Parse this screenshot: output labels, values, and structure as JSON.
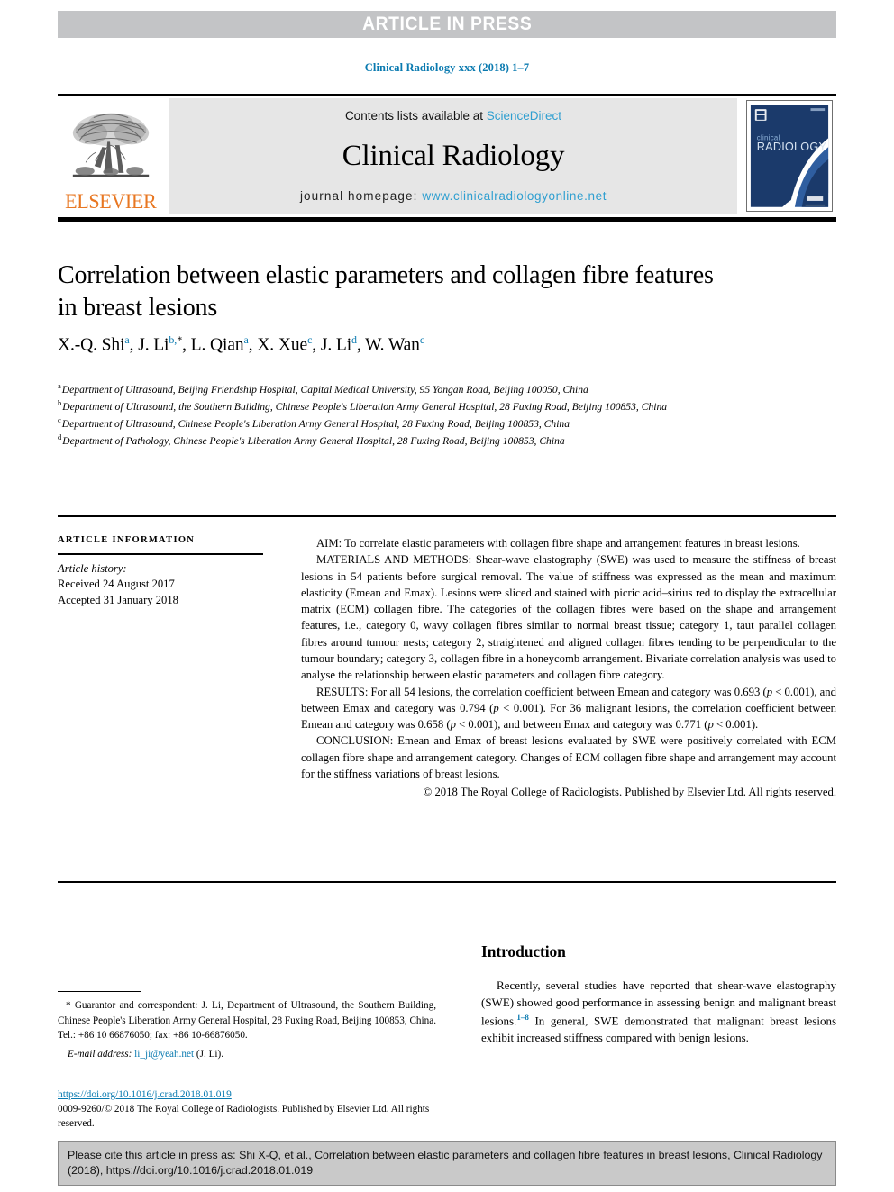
{
  "banner": {
    "text": "ARTICLE IN PRESS"
  },
  "running_head": "Clinical Radiology xxx (2018) 1–7",
  "masthead": {
    "publisher_logo_label": "ELSEVIER",
    "contents_prefix": "Contents lists available at ",
    "contents_link": "ScienceDirect",
    "journal_name": "Clinical Radiology",
    "homepage_prefix": "journal homepage: ",
    "homepage_url": "www.clinicalradiologyonline.net",
    "cover_title_small": "clinical",
    "cover_title_large": "RADIOLOGY"
  },
  "article": {
    "title": "Correlation between elastic parameters and collagen fibre features in breast lesions",
    "authors": [
      {
        "name": "X.-Q. Shi",
        "marks": "a",
        "corresponding": false
      },
      {
        "name": "J. Li",
        "marks": "b",
        "corresponding": true
      },
      {
        "name": "L. Qian",
        "marks": "a",
        "corresponding": false
      },
      {
        "name": "X. Xue",
        "marks": "c",
        "corresponding": false
      },
      {
        "name": "J. Li",
        "marks": "d",
        "corresponding": false
      },
      {
        "name": "W. Wan",
        "marks": "c",
        "corresponding": false
      }
    ],
    "affiliations": [
      {
        "mark": "a",
        "text": "Department of Ultrasound, Beijing Friendship Hospital, Capital Medical University, 95 Yongan Road, Beijing 100050, China"
      },
      {
        "mark": "b",
        "text": "Department of Ultrasound, the Southern Building, Chinese People's Liberation Army General Hospital, 28 Fuxing Road, Beijing 100853, China"
      },
      {
        "mark": "c",
        "text": "Department of Ultrasound, Chinese People's Liberation Army General Hospital, 28 Fuxing Road, Beijing 100853, China"
      },
      {
        "mark": "d",
        "text": "Department of Pathology, Chinese People's Liberation Army General Hospital, 28 Fuxing Road, Beijing 100853, China"
      }
    ]
  },
  "article_information": {
    "heading": "ARTICLE INFORMATION",
    "history_label": "Article history:",
    "received": "Received 24 August 2017",
    "accepted": "Accepted 31 January 2018"
  },
  "abstract": {
    "aim": "AIM: To correlate elastic parameters with collagen fibre shape and arrangement features in breast lesions.",
    "materials_and_methods": "MATERIALS AND METHODS: Shear-wave elastography (SWE) was used to measure the stiffness of breast lesions in 54 patients before surgical removal. The value of stiffness was expressed as the mean and maximum elasticity (Emean and Emax). Lesions were sliced and stained with picric acid–sirius red to display the extracellular matrix (ECM) collagen fibre. The categories of the collagen fibres were based on the shape and arrangement features, i.e., category 0, wavy collagen fibres similar to normal breast tissue; category 1, taut parallel collagen fibres around tumour nests; category 2, straightened and aligned collagen fibres tending to be perpendicular to the tumour boundary; category 3, collagen fibre in a honeycomb arrangement. Bivariate correlation analysis was used to analyse the relationship between elastic parameters and collagen fibre category.",
    "results": "RESULTS: For all 54 lesions, the correlation coefficient between Emean and category was 0.693 (p < 0.001), and between Emax and category was 0.794 (p < 0.001). For 36 malignant lesions, the correlation coefficient between Emean and category was 0.658 (p < 0.001), and between Emax and category was 0.771 (p < 0.001).",
    "conclusion": "CONCLUSION: Emean and Emax of breast lesions evaluated by SWE were positively correlated with ECM collagen fibre shape and arrangement category. Changes of ECM collagen fibre shape and arrangement may account for the stiffness variations of breast lesions.",
    "copyright": "© 2018 The Royal College of Radiologists. Published by Elsevier Ltd. All rights reserved."
  },
  "introduction": {
    "heading": "Introduction",
    "paragraph_before_ref": "Recently, several studies have reported that shear-wave elastography (SWE) showed good performance in assessing benign and malignant breast lesions.",
    "reference_marker": "1–8",
    "paragraph_after_ref": " In general, SWE demonstrated that malignant breast lesions exhibit increased stiffness compared with benign lesions."
  },
  "footnotes": {
    "correspondence": "* Guarantor and correspondent: J. Li, Department of Ultrasound, the Southern Building, Chinese People's Liberation Army General Hospital, 28 Fuxing Road, Beijing 100853, China. Tel.: +86 10 66876050; fax: +86 10-66876050.",
    "email_label": "E-mail address:",
    "email": "li_ji@yeah.net",
    "email_suffix": "(J. Li).",
    "doi": "https://doi.org/10.1016/j.crad.2018.01.019",
    "issn_copyright": "0009-9260/© 2018 The Royal College of Radiologists. Published by Elsevier Ltd. All rights reserved."
  },
  "cite_footer": {
    "text": "Please cite this article in press as: Shi X-Q, et al., Correlation between elastic parameters and collagen fibre features in breast lesions, Clinical Radiology (2018), https://doi.org/10.1016/j.crad.2018.01.019"
  },
  "colors": {
    "link_blue": "#0a7ab0",
    "sciencedirect_blue": "#2f9fd0",
    "elsevier_orange": "#e87722",
    "banner_gray": "#c3c4c6",
    "panel_gray": "#e6e6e6",
    "cover_navy": "#1b3a6b",
    "cite_box_gray": "#c9c9c9"
  }
}
